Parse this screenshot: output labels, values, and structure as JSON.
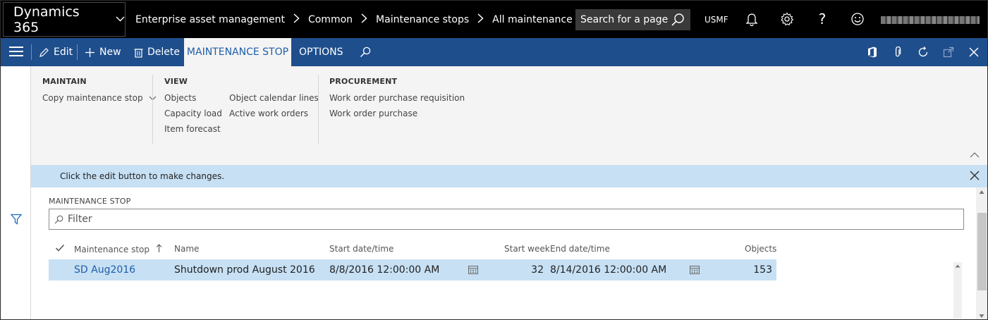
{
  "topbar": {
    "brand": "Dynamics 365",
    "breadcrumb": [
      "Enterprise asset management",
      "Common",
      "Maintenance stops",
      "All maintenance stops"
    ],
    "search_placeholder": "Search for a page",
    "company": "USMF"
  },
  "actionbar": {
    "edit_label": "Edit",
    "new_label": "New",
    "delete_label": "Delete",
    "tabs": [
      {
        "label": "MAINTENANCE STOP",
        "active": true
      },
      {
        "label": "OPTIONS",
        "active": false
      }
    ]
  },
  "ribbon": {
    "groups": [
      {
        "title": "MAINTAIN",
        "items": [
          "Copy maintenance stop"
        ]
      },
      {
        "title": "VIEW",
        "items": [
          "Objects",
          "Capacity load",
          "Item forecast",
          "Object calendar lines",
          "Active work orders"
        ]
      },
      {
        "title": "PROCUREMENT",
        "items": [
          "Work order purchase requisition",
          "Work order purchase"
        ]
      }
    ]
  },
  "message": "Click the edit button to make changes.",
  "section_title": "MAINTENANCE STOP",
  "filter_placeholder": "Filter",
  "grid": {
    "headers": {
      "maintenance_stop": "Maintenance stop",
      "name": "Name",
      "start": "Start date/time",
      "start_week": "Start week",
      "end": "End date/time",
      "objects": "Objects"
    },
    "rows": [
      {
        "maintenance_stop": "SD Aug2016",
        "name": "Shutdown prod August 2016",
        "start": "8/8/2016 12:00:00 AM",
        "start_week": "32",
        "end": "8/14/2016 12:00:00 AM",
        "objects": "153"
      }
    ]
  },
  "colors": {
    "topbar": "#000000",
    "actionbar": "#1f4e8c",
    "selected_row": "#c7e0f4",
    "link": "#1f5ea8"
  }
}
